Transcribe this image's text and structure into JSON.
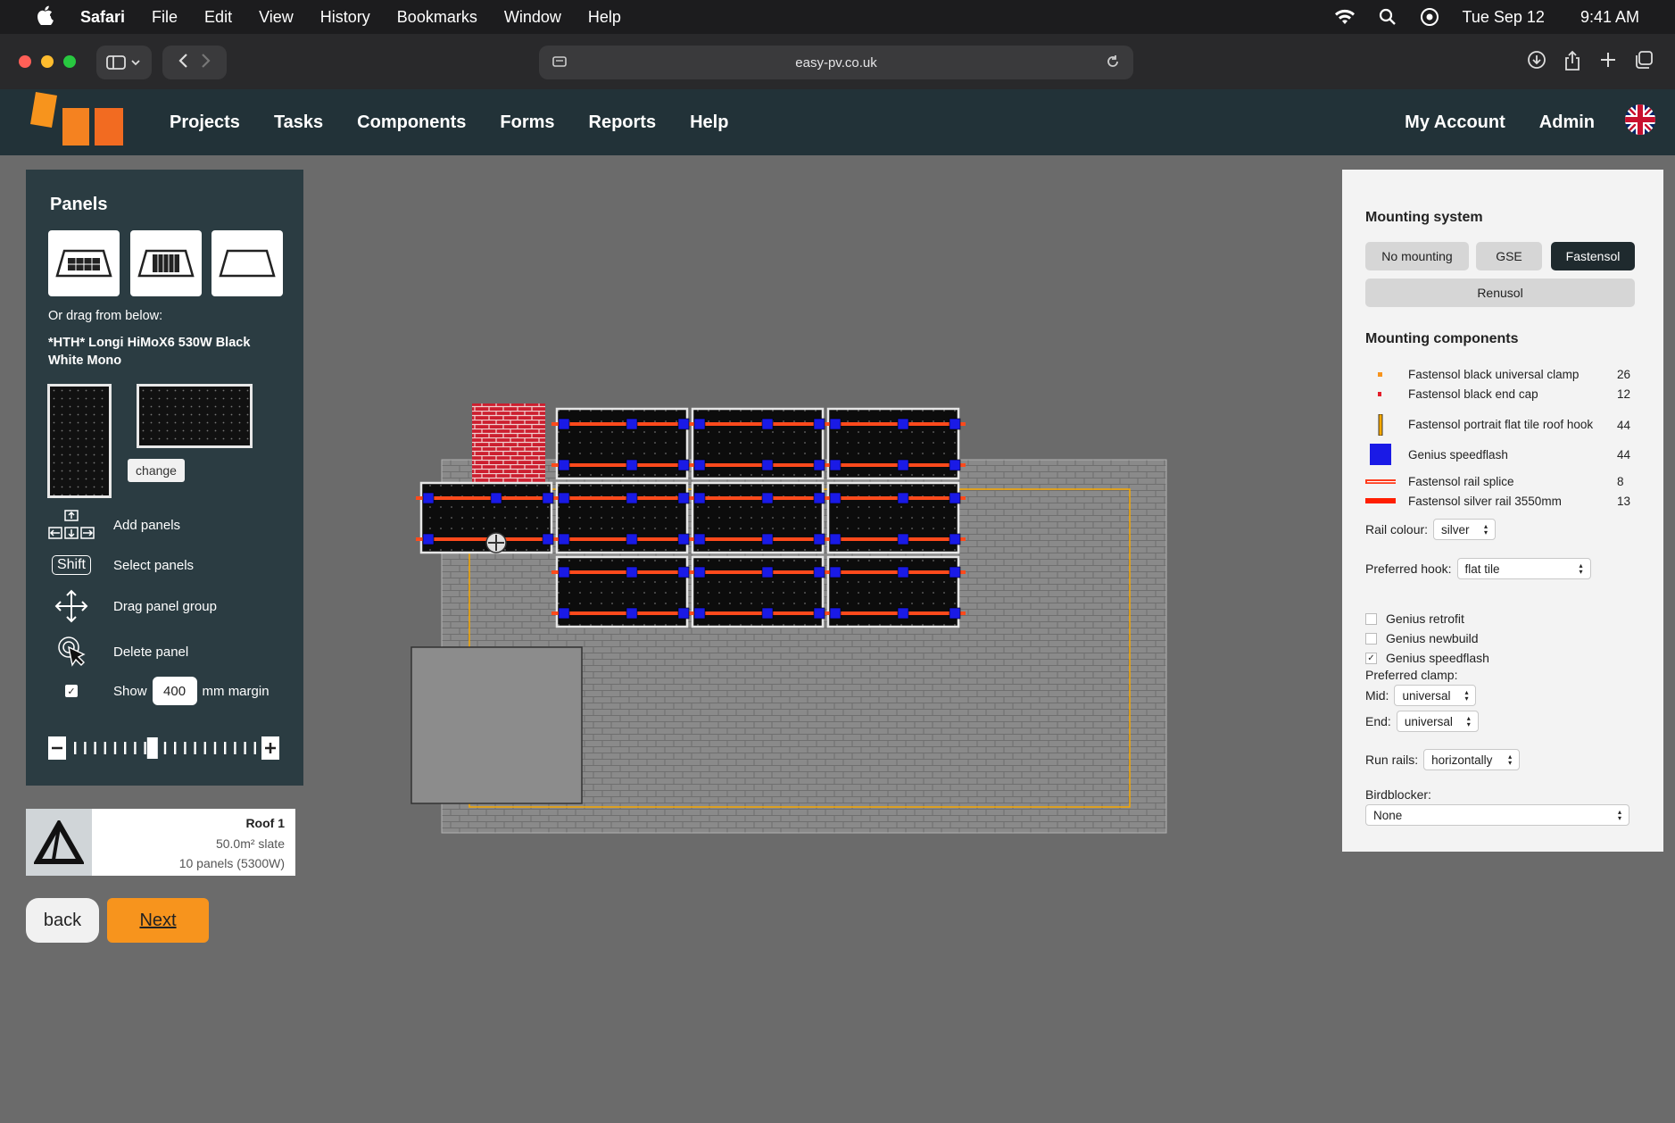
{
  "menubar": {
    "app": "Safari",
    "items": [
      "File",
      "Edit",
      "View",
      "History",
      "Bookmarks",
      "Window",
      "Help"
    ],
    "date": "Tue Sep 12",
    "time": "9:41 AM"
  },
  "browser": {
    "url": "easy-pv.co.uk"
  },
  "nav": {
    "links": [
      "Projects",
      "Tasks",
      "Components",
      "Forms",
      "Reports",
      "Help"
    ],
    "account": "My Account",
    "admin": "Admin"
  },
  "panels": {
    "title": "Panels",
    "drag_hint": "Or drag from below:",
    "panel_name": "*HTH* Longi HiMoX6 530W Black White Mono",
    "change": "change",
    "tools": {
      "add": "Add panels",
      "select_key": "Shift",
      "select": "Select panels",
      "drag": "Drag panel group",
      "delete": "Delete panel"
    },
    "margin": {
      "show": "Show",
      "value": "400",
      "unit": "mm margin",
      "checked": true
    },
    "zoom_level": 0.45
  },
  "roof": {
    "name": "Roof 1",
    "area": "50.0m² slate",
    "panels": "10 panels (5300W)"
  },
  "buttons": {
    "back": "back",
    "next": "Next"
  },
  "mounting": {
    "title": "Mounting system",
    "options": [
      "No mounting",
      "GSE",
      "Fastensol"
    ],
    "active": "Fastensol",
    "renusol": "Renusol",
    "components_title": "Mounting components",
    "components": [
      {
        "name": "Fastensol black universal clamp",
        "qty": "26",
        "swatch": "orange-dot"
      },
      {
        "name": "Fastensol black end cap",
        "qty": "12",
        "swatch": "red-dot"
      },
      {
        "name": "Fastensol portrait flat tile roof hook",
        "qty": "44",
        "swatch": "hook-bar"
      },
      {
        "name": "Genius speedflash",
        "qty": "44",
        "swatch": "blue-square"
      },
      {
        "name": "Fastensol rail splice",
        "qty": "8",
        "swatch": "splice-line"
      },
      {
        "name": "Fastensol silver rail 3550mm",
        "qty": "13",
        "swatch": "rail-line"
      }
    ],
    "rail_colour_label": "Rail colour:",
    "rail_colour": "silver",
    "hook_label": "Preferred hook:",
    "hook": "flat tile",
    "checks": [
      {
        "label": "Genius retrofit",
        "checked": false
      },
      {
        "label": "Genius newbuild",
        "checked": false
      },
      {
        "label": "Genius speedflash",
        "checked": true
      }
    ],
    "clamp_label": "Preferred clamp:",
    "mid_label": "Mid:",
    "mid": "universal",
    "end_label": "End:",
    "end": "universal",
    "run_rails_label": "Run rails:",
    "run_rails": "horizontally",
    "birdblocker_label": "Birdblocker:",
    "birdblocker": "None"
  },
  "colors": {
    "nav_bg": "#223238",
    "panel_bg": "#2b3c42",
    "accent": "#f7941d",
    "rail": "#ff4a1c",
    "flash": "#1a1ae6",
    "canvas_bg": "#6b6b6b"
  }
}
